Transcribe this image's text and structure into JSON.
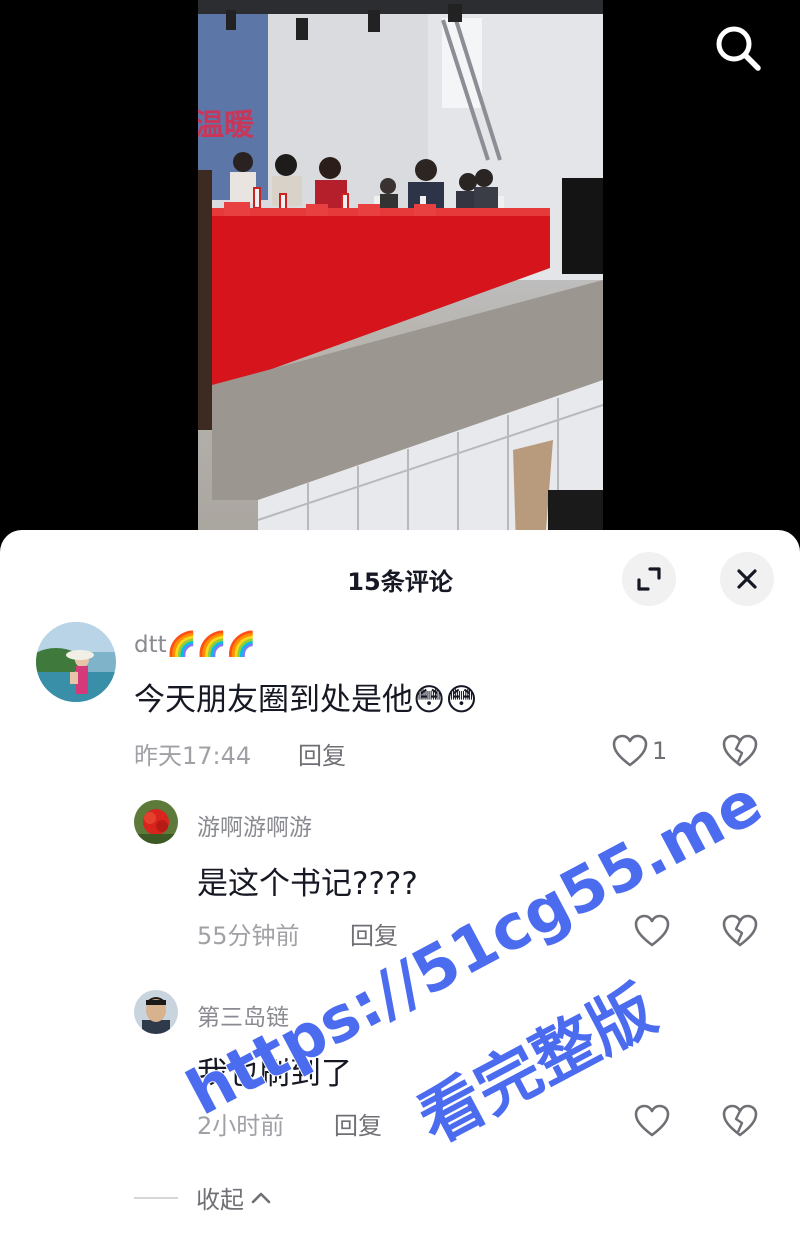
{
  "header": {
    "comment_count_title": "15条评论",
    "expand_icon": "expand-icon",
    "close_icon": "close-icon",
    "search_icon": "search-icon"
  },
  "video": {
    "banner_text": "温暖"
  },
  "comments": [
    {
      "username": "dtt",
      "username_emojis": "🌈🌈🌈",
      "text": "今天朋友圈到处是他",
      "text_emojis": "😳😳",
      "time": "昨天17:44",
      "reply_label": "回复",
      "likes": "1"
    },
    {
      "username": "游啊游啊游",
      "text": "是这个书记????",
      "time": "55分钟前",
      "reply_label": "回复",
      "likes": ""
    },
    {
      "username": "第三岛链",
      "text": "我也刷到了",
      "time": "2小时前",
      "reply_label": "回复",
      "likes": ""
    }
  ],
  "collapse_label": "收起",
  "watermark": {
    "url": "https://51cg55.me",
    "cta": "看完整版"
  },
  "colors": {
    "accent_watermark": "#4c6cf0",
    "text_primary": "#161823",
    "text_secondary": "#8a8b91"
  }
}
